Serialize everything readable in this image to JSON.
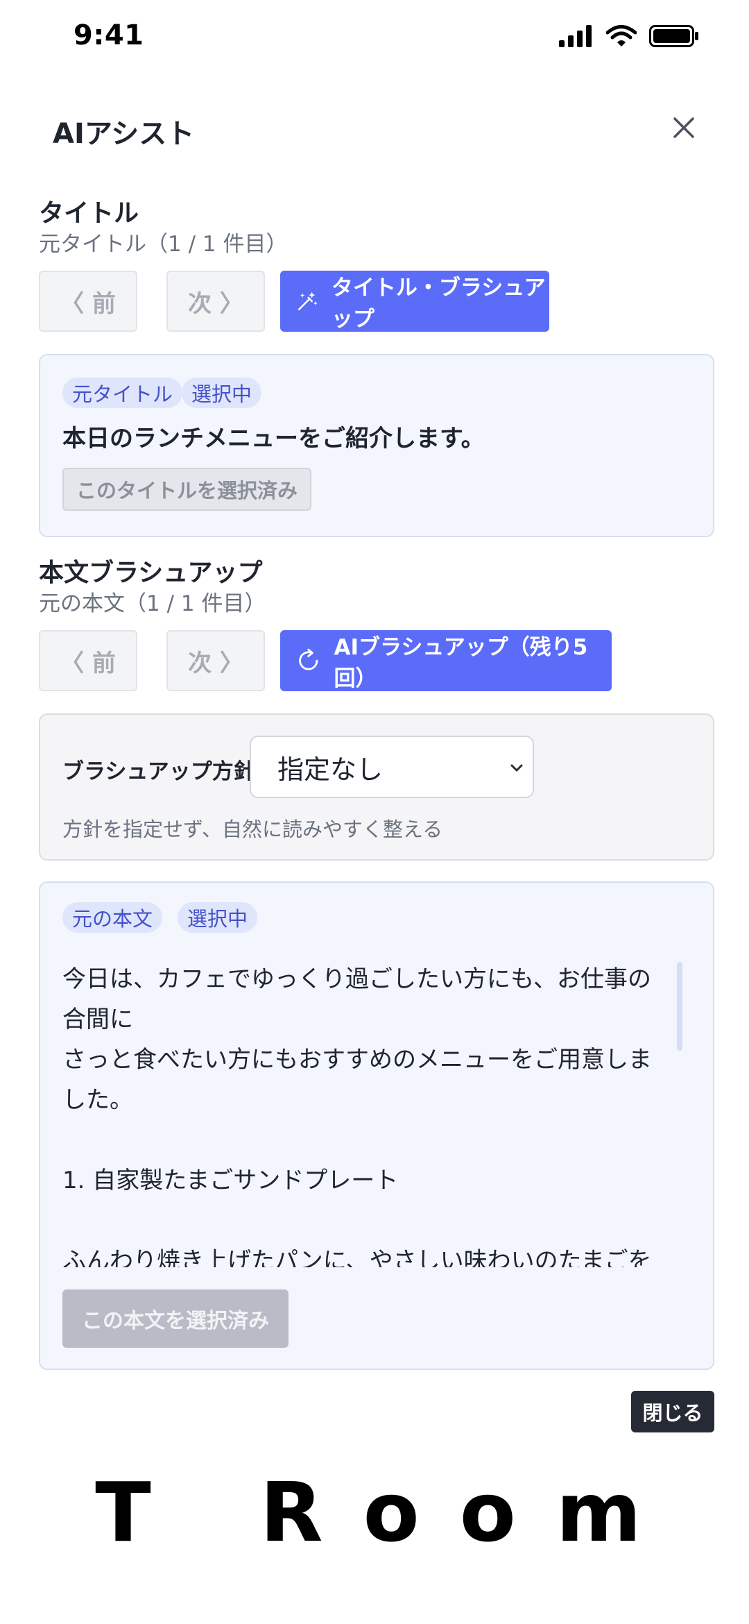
{
  "status_bar": {
    "time": "9:41"
  },
  "header": {
    "title": "AIアシスト",
    "close_icon": "close-icon"
  },
  "title_section": {
    "heading": "タイトル",
    "subheading": "元タイトル（1 / 1 件目）",
    "prev_label": "〈 前",
    "next_label": "次 〉",
    "brushup_label": "タイトル・ブラシュアップ",
    "brushup_icon": "magic-wand-icon",
    "card": {
      "chip_original": "元タイトル",
      "chip_selected": "選択中",
      "title_text": "本日のランチメニューをご紹介します。",
      "selected_button": "このタイトルを選択済み"
    }
  },
  "body_section": {
    "heading": "本文ブラシュアップ",
    "subheading": "元の本文（1 / 1 件目）",
    "prev_label": "〈 前",
    "next_label": "次 〉",
    "brushup_label": "AIブラシュアップ（残り5回）",
    "brushup_icon": "refresh-icon",
    "policy": {
      "label": "ブラシュアップ方針",
      "selected_value": "指定なし",
      "description": "方針を指定せず、自然に読みやすく整える"
    },
    "card": {
      "chip_original": "元の本文",
      "chip_selected": "選択中",
      "body_text": "今日は、カフェでゆっくり過ごしたい方にも、お仕事の合間に\nさっと食べたい方にもおすすめのメニューをご用意しました。\n\n1. 自家製たまごサンドプレート\n\nふんわり焼き上げたパンに、やさしい味わいのたまごをたっぷ\nり挟んだ定番メニューです。\nミニサラダとスープ付きで、軽めのランチにもぴったりです。",
      "selected_button": "この本文を選択済み"
    }
  },
  "footer": {
    "close_button": "閉じる",
    "logo_text": "T Room"
  },
  "colors": {
    "primary": "#5b6cf8",
    "chip_bg": "#dfe5fb",
    "chip_text": "#4452c9",
    "dark_button": "#262a35"
  }
}
